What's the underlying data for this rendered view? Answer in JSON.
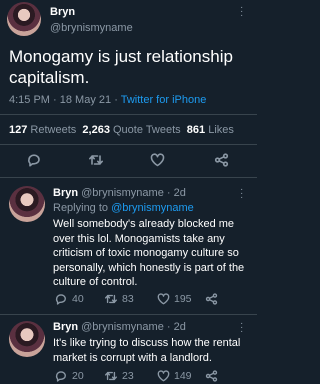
{
  "main_tweet": {
    "display_name": "Bryn",
    "handle": "@brynismyname",
    "text": "Monogamy is just relationship capitalism.",
    "time": "4:15 PM",
    "sep": "·",
    "date": "18 May 21",
    "source": "Twitter for iPhone",
    "retweets_count": "127",
    "retweets_label": "Retweets",
    "quotes_count": "2,263",
    "quotes_label": "Quote Tweets",
    "likes_count": "861",
    "likes_label": "Likes"
  },
  "reply1": {
    "display_name": "Bryn",
    "handle": "@brynismyname",
    "time": "· 2d",
    "replying_prefix": "Replying to",
    "replying_handle": "@brynismyname",
    "line1": "Well somebody's already blocked me",
    "line2": "over this lol. Monogamists take any",
    "line3": "criticism of toxic monogamy culture so",
    "line4": "personally, which honestly is part of the",
    "line5": "culture of control.",
    "replies": "40",
    "retweets": "83",
    "likes": "195"
  },
  "reply2": {
    "display_name": "Bryn",
    "handle": "@brynismyname",
    "time": "· 2d",
    "line1": "It's like trying to discuss how the rental",
    "line2": "market is corrupt with a landlord.",
    "replies": "20",
    "retweets": "23",
    "likes": "149"
  },
  "colors": {
    "background": "#15202b",
    "accent": "#1d9bf0",
    "muted": "#8b98a5",
    "divider": "#38444d"
  },
  "icons": [
    "reply-icon",
    "retweet-icon",
    "like-icon",
    "share-icon",
    "more-icon"
  ]
}
